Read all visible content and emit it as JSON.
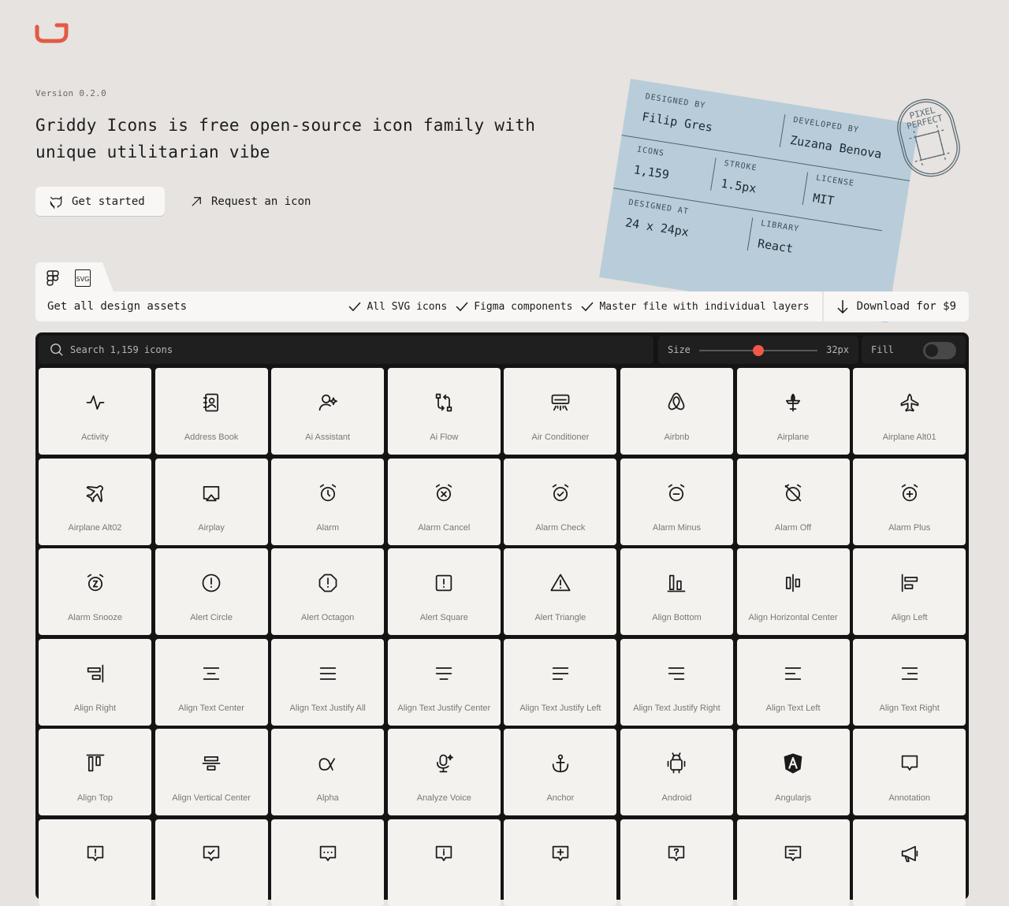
{
  "version": "Version 0.2.0",
  "headline": "Griddy Icons is free open-source icon family with unique utilitarian vibe",
  "actions": {
    "get_started": "Get started",
    "request": "Request an icon"
  },
  "ticket": {
    "designed_by_label": "Designed by",
    "designed_by": "Filip Gres",
    "developed_by_label": "Developed by",
    "developed_by": "Zuzana Benova",
    "icons_label": "Icons",
    "icons": "1,159",
    "stroke_label": "Stroke",
    "stroke": "1.5px",
    "license_label": "License",
    "license": "MIT",
    "designed_at_label": "Designed at",
    "designed_at": "24 x 24px",
    "library_label": "Library",
    "library": "React",
    "stamp_text": "PIXEL PERFECT"
  },
  "assets": {
    "title": "Get all design assets",
    "features": [
      "All SVG icons",
      "Figma components",
      "Master file with individual layers"
    ],
    "download": "Download for $9",
    "svg_tab": "SVG"
  },
  "toolbar": {
    "search_placeholder": "Search 1,159 icons",
    "size_label": "Size",
    "size_value": "32px",
    "size_fraction": 0.5,
    "fill_label": "Fill",
    "fill_on": false
  },
  "colors": {
    "brand": "#e35a43",
    "slider": "#f0584a"
  },
  "icons": [
    {
      "label": "Activity",
      "icon": "activity-icon"
    },
    {
      "label": "Address Book",
      "icon": "address-book-icon"
    },
    {
      "label": "Ai Assistant",
      "icon": "ai-assistant-icon"
    },
    {
      "label": "Ai Flow",
      "icon": "ai-flow-icon"
    },
    {
      "label": "Air Conditioner",
      "icon": "air-conditioner-icon"
    },
    {
      "label": "Airbnb",
      "icon": "airbnb-icon"
    },
    {
      "label": "Airplane",
      "icon": "airplane-icon"
    },
    {
      "label": "Airplane Alt01",
      "icon": "airplane-alt01-icon"
    },
    {
      "label": "Airplane Alt02",
      "icon": "airplane-alt02-icon"
    },
    {
      "label": "Airplay",
      "icon": "airplay-icon"
    },
    {
      "label": "Alarm",
      "icon": "alarm-icon"
    },
    {
      "label": "Alarm Cancel",
      "icon": "alarm-cancel-icon"
    },
    {
      "label": "Alarm Check",
      "icon": "alarm-check-icon"
    },
    {
      "label": "Alarm Minus",
      "icon": "alarm-minus-icon"
    },
    {
      "label": "Alarm Off",
      "icon": "alarm-off-icon"
    },
    {
      "label": "Alarm Plus",
      "icon": "alarm-plus-icon"
    },
    {
      "label": "Alarm Snooze",
      "icon": "alarm-snooze-icon"
    },
    {
      "label": "Alert Circle",
      "icon": "alert-circle-icon"
    },
    {
      "label": "Alert Octagon",
      "icon": "alert-octagon-icon"
    },
    {
      "label": "Alert Square",
      "icon": "alert-square-icon"
    },
    {
      "label": "Alert Triangle",
      "icon": "alert-triangle-icon"
    },
    {
      "label": "Align Bottom",
      "icon": "align-bottom-icon"
    },
    {
      "label": "Align Horizontal Center",
      "icon": "align-horizontal-center-icon"
    },
    {
      "label": "Align Left",
      "icon": "align-left-icon"
    },
    {
      "label": "Align Right",
      "icon": "align-right-icon"
    },
    {
      "label": "Align Text Center",
      "icon": "align-text-center-icon"
    },
    {
      "label": "Align Text Justify All",
      "icon": "align-text-justify-all-icon"
    },
    {
      "label": "Align Text Justify Center",
      "icon": "align-text-justify-center-icon"
    },
    {
      "label": "Align Text Justify Left",
      "icon": "align-text-justify-left-icon"
    },
    {
      "label": "Align Text Justify Right",
      "icon": "align-text-justify-right-icon"
    },
    {
      "label": "Align Text Left",
      "icon": "align-text-left-icon"
    },
    {
      "label": "Align Text Right",
      "icon": "align-text-right-icon"
    },
    {
      "label": "Align Top",
      "icon": "align-top-icon"
    },
    {
      "label": "Align Vertical Center",
      "icon": "align-vertical-center-icon"
    },
    {
      "label": "Alpha",
      "icon": "alpha-icon"
    },
    {
      "label": "Analyze Voice",
      "icon": "analyze-voice-icon"
    },
    {
      "label": "Anchor",
      "icon": "anchor-icon"
    },
    {
      "label": "Android",
      "icon": "android-icon"
    },
    {
      "label": "Angularjs",
      "icon": "angularjs-icon"
    },
    {
      "label": "Annotation",
      "icon": "annotation-icon"
    },
    {
      "label": "",
      "icon": "annotation-alert-icon"
    },
    {
      "label": "",
      "icon": "annotation-check-icon"
    },
    {
      "label": "",
      "icon": "annotation-dots-icon"
    },
    {
      "label": "",
      "icon": "annotation-info-icon"
    },
    {
      "label": "",
      "icon": "annotation-plus-icon"
    },
    {
      "label": "",
      "icon": "annotation-question-icon"
    },
    {
      "label": "",
      "icon": "annotation-text-icon"
    },
    {
      "label": "",
      "icon": "announcement-icon"
    }
  ]
}
